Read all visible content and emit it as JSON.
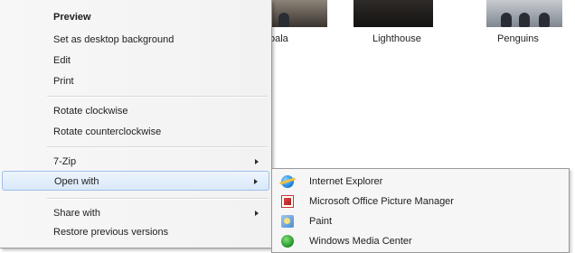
{
  "explorer": {
    "thumbnails": [
      {
        "label": "oala"
      },
      {
        "label": "Lighthouse"
      },
      {
        "label": "Penguins"
      }
    ]
  },
  "context_menu": {
    "items": [
      {
        "label": "Preview",
        "bold": true
      },
      {
        "label": "Set as desktop background"
      },
      {
        "label": "Edit"
      },
      {
        "label": "Print"
      },
      {
        "label": "Rotate clockwise"
      },
      {
        "label": "Rotate counterclockwise"
      },
      {
        "label": "7-Zip",
        "submenu": true
      },
      {
        "label": "Open with",
        "submenu": true,
        "highlighted": true
      },
      {
        "label": "Share with",
        "submenu": true
      },
      {
        "label": "Restore previous versions"
      }
    ]
  },
  "open_with_submenu": {
    "items": [
      {
        "label": "Internet Explorer",
        "icon": "internet-explorer-icon"
      },
      {
        "label": "Microsoft Office Picture Manager",
        "icon": "picture-manager-icon"
      },
      {
        "label": "Paint",
        "icon": "paint-icon"
      },
      {
        "label": "Windows Media Center",
        "icon": "windows-media-center-icon"
      }
    ]
  },
  "colors": {
    "highlight_border": "#9dc1ea",
    "highlight_fill": "#d9e8fa",
    "menu_background": "#f2f2f2"
  }
}
